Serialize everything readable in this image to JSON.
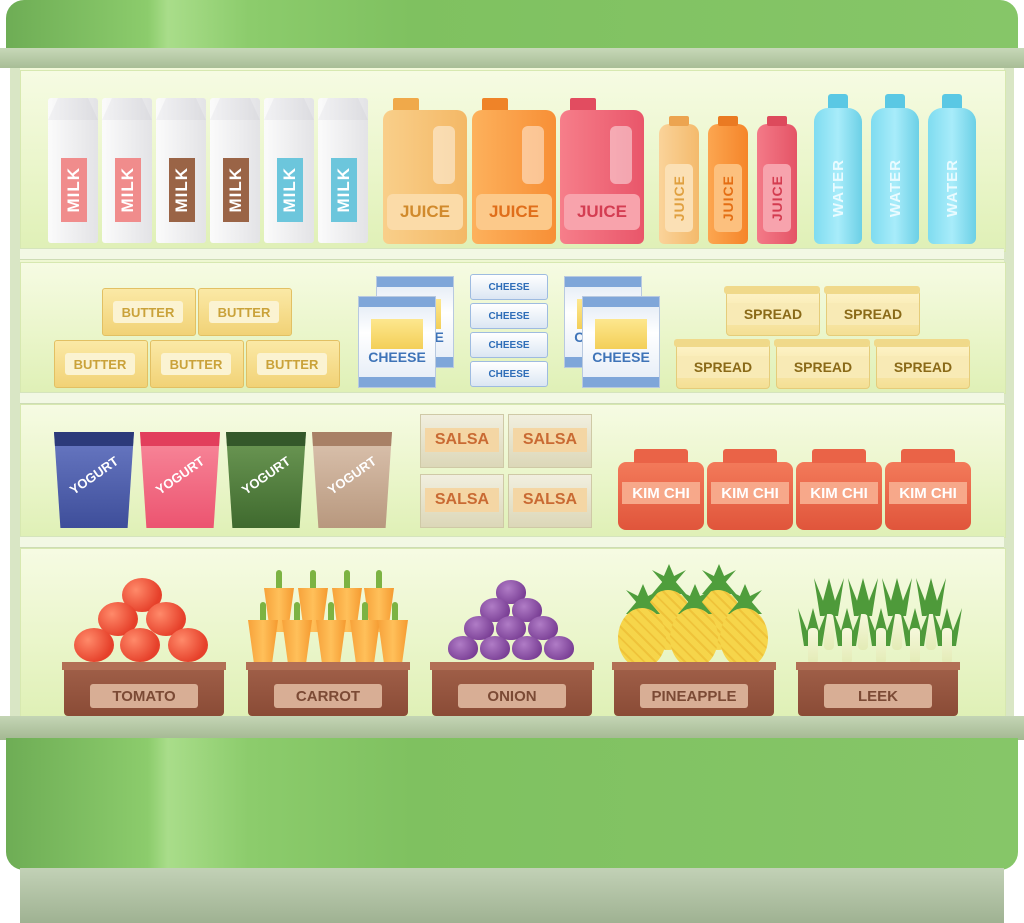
{
  "scene": {
    "colors": {
      "frame_green": "#7fc160",
      "rail_gray": "#b5c6a6",
      "interior": "#eef7d2"
    },
    "shelf_1": {
      "milk": [
        "MILK",
        "MILK",
        "MILK",
        "MILK",
        "MILK",
        "MILK"
      ],
      "milk_colors": [
        "#f08c8c",
        "#f08c8c",
        "#9a6446",
        "#9a6446",
        "#6cc6dc",
        "#6cc6dc"
      ],
      "juice_jugs": [
        "JUICE",
        "JUICE",
        "JUICE"
      ],
      "juice_jug_colors": [
        "#f7c77a",
        "#f9a04c",
        "#ef6b7a"
      ],
      "juice_bottles": [
        "JUICE",
        "JUICE",
        "JUICE"
      ],
      "juice_bottle_colors": [
        "#f8c27a",
        "#f7953e",
        "#ef6476"
      ],
      "water": [
        "WATER",
        "WATER",
        "WATER"
      ]
    },
    "shelf_2": {
      "butter": [
        "BUTTER",
        "BUTTER",
        "BUTTER",
        "BUTTER",
        "BUTTER"
      ],
      "cheese_bags": [
        "CHEESE",
        "CHEESE",
        "CHEESE",
        "CHEESE"
      ],
      "cheese_sticks": [
        "CHEESE",
        "CHEESE",
        "CHEESE",
        "CHEESE"
      ],
      "spread": [
        "SPREAD",
        "SPREAD",
        "SPREAD",
        "SPREAD",
        "SPREAD"
      ]
    },
    "shelf_3": {
      "yogurt": [
        "YOGURT",
        "YOGURT",
        "YOGURT",
        "YOGURT"
      ],
      "yogurt_colors": [
        "#4a5aa8",
        "#f26a82",
        "#4e7a3c",
        "#c6a892"
      ],
      "salsa": [
        "SALSA",
        "SALSA",
        "SALSA",
        "SALSA"
      ],
      "kimchi": [
        "KIM CHI",
        "KIM CHI",
        "KIM CHI",
        "KIM CHI"
      ]
    },
    "shelf_4": {
      "produce": [
        "TOMATO",
        "CARROT",
        "ONION",
        "PINEAPPLE",
        "LEEK"
      ]
    }
  }
}
